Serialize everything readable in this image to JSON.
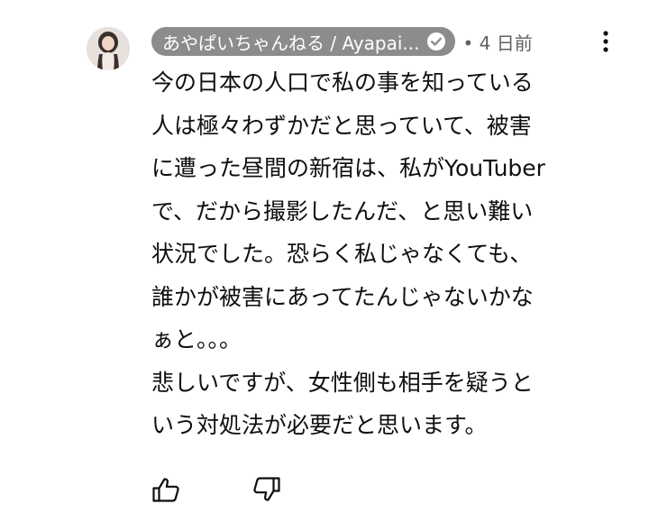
{
  "comment": {
    "author": "あやぱいちゃんねる / Ayapai...",
    "time_prefix": "•",
    "time": "4 日前",
    "lines": [
      "今の日本の人口で私の事を知っている",
      "人は極々わずかだと思っていて、被害",
      "に遭った昼間の新宿は、私がYouTuber",
      "で、だから撮影したんだ、と思い難い",
      "状況でした。恐らく私じゃなくても、",
      "誰かが被害にあってたんじゃないかな",
      "ぁと。。。",
      "悲しいですが、女性側も相手を疑うと",
      "いう対処法が必要だと思います。"
    ]
  },
  "icons": {
    "avatar": "avatar",
    "verified": "verified-check-icon",
    "menu": "more-vert-icon",
    "like": "thumbs-up-icon",
    "dislike": "thumbs-down-icon"
  },
  "colors": {
    "author_chip_bg": "#8c8c8c",
    "author_chip_text": "#ffffff",
    "meta_text": "#606060",
    "body_text": "#0f0f0f"
  }
}
